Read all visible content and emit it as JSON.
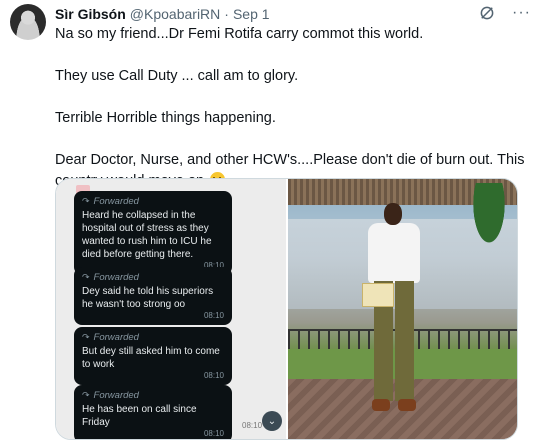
{
  "tweet": {
    "author_name": "Sìr Gibsón",
    "author_handle": "@KpoabariRN",
    "separator": "·",
    "date": "Sep 1",
    "paragraphs": [
      "Na so my friend...Dr Femi Rotifa carry commot this world.",
      "They use Call Duty ... call am to glory.",
      "Terrible Horrible things happening.",
      "Dear Doctor, Nurse, and other HCW's....Please don't die of burn out. This country would move on"
    ],
    "more_glyph": "···"
  },
  "media": {
    "chat": {
      "messages": [
        {
          "forwarded_label": "Forwarded",
          "text": "Heard he collapsed in the hospital out of stress as they wanted to rush him to ICU he died before getting there.",
          "time": "08:10"
        },
        {
          "forwarded_label": "Forwarded",
          "text": "Dey said he told his superiors he wasn't too strong oo",
          "time": "08:10"
        },
        {
          "forwarded_label": "Forwarded",
          "text": "But dey still asked him to come to work",
          "time": "08:10"
        },
        {
          "forwarded_label": "Forwarded",
          "text": "He has been on call since Friday",
          "time": "08:10"
        }
      ],
      "side_time": "08:10",
      "scroll_icon": "chevron-down"
    }
  },
  "icons": {
    "grok": "grok-icon",
    "more": "more-icon",
    "forward": "forward-arrow-icon",
    "emoji": "sad-face-emoji"
  },
  "colors": {
    "text": "#0f1419",
    "muted": "#536471",
    "bubble_bg": "#0b1114",
    "bubble_text": "#e9edef",
    "border": "#cfd9de"
  }
}
